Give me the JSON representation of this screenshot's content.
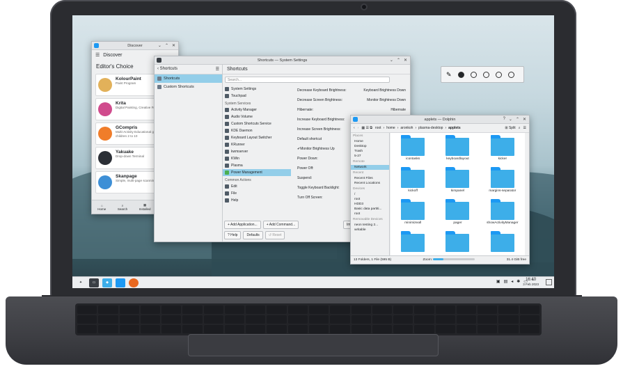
{
  "discover": {
    "title": "Discover",
    "header": "Discover",
    "editors_choice": "Editor's Choice",
    "apps": [
      {
        "name": "KolourPaint",
        "desc": "Paint Program",
        "color": "#e2b15a"
      },
      {
        "name": "Krita",
        "desc": "Digital Painting, Creative Freedom",
        "color": "#d04b8d"
      },
      {
        "name": "GCompris",
        "desc": "Multi-Activity Educational game for children 2 to 10",
        "color": "#f07d2a"
      },
      {
        "name": "Yakuake",
        "desc": "Drop-down Terminal",
        "color": "#2b2f36"
      },
      {
        "name": "Skanpage",
        "desc": "Simple, multi-page scanning application",
        "color": "#3d8fd6"
      }
    ],
    "nav": [
      "Home",
      "Search",
      "Installed",
      "Update"
    ]
  },
  "settings": {
    "title": "Shortcuts — System Settings",
    "sidebar_header": "Shortcuts",
    "sidebar_items": [
      "Shortcuts",
      "Custom Shortcuts"
    ],
    "page_title": "Shortcuts",
    "search_placeholder": "Search...",
    "list_top": [
      "System Settings",
      "Touchpad"
    ],
    "group_system": "System Services",
    "system_items": [
      "Activity Manager",
      "Audio Volume",
      "Custom Shortcuts Service",
      "KDE Daemon",
      "Keyboard Layout Switcher",
      "KRunner",
      "kwmserver",
      "KWin",
      "Plasma",
      "Power Management"
    ],
    "group_common": "Common Actions",
    "common_items": [
      "Edit",
      "File",
      "Help"
    ],
    "rows": [
      {
        "label": "Decrease Keyboard Brightness:",
        "value": "Keyboard Brightness Down"
      },
      {
        "label": "Decrease Screen Brightness:",
        "value": "Monitor Brightness Down"
      },
      {
        "label": "Hibernate:",
        "value": "Hibernate"
      },
      {
        "label": "Increase Keyboard Brightness:",
        "value": ""
      },
      {
        "label": "Increase Screen Brightness:",
        "value": ""
      }
    ],
    "default_shortcut": "Default shortcut",
    "default_value": "Monitor Brightness Up",
    "rows2": [
      "Power Down:",
      "Power Off:",
      "Suspend:",
      "Toggle Keyboard Backlight:",
      "Turn Off Screen:"
    ],
    "buttons": {
      "add_app": "Add Application...",
      "add_command": "Add Command...",
      "help": "Help",
      "defaults": "Defaults",
      "reset": "Reset",
      "import": "Import"
    }
  },
  "dolphin": {
    "title": "applets — Dolphin",
    "breadcrumb": [
      "root",
      "home",
      "aronkoh",
      "plasma-desktop",
      "applets"
    ],
    "split": "Split",
    "places_header": "Places",
    "places": [
      "Home",
      "Desktop",
      "Trash",
      "5-27"
    ],
    "remote_header": "Remote",
    "remote": [
      "Network"
    ],
    "recent_header": "Recent",
    "recent": [
      "Recent Files",
      "Recent Locations"
    ],
    "devices_header": "Devices",
    "devices": [
      "/",
      "root",
      "HDD3",
      "Basic data partiti...",
      "root"
    ],
    "removable_header": "Removable Devices",
    "removable": [
      "neon testing 2...",
      "writable"
    ],
    "folders": [
      "icontasks",
      "keyboardlayout",
      "kicker",
      "kickoff",
      "kimpanel",
      "margins-separator",
      "minimizeall",
      "pager",
      "showActivityManager",
      "",
      "",
      ""
    ],
    "status": "13 Folders, 1 File (595 B)",
    "zoom_label": "Zoom:",
    "zoom_level": 0.25,
    "free": "31.4 GiB free"
  },
  "clock": {
    "time": "16:40",
    "date": "3 Feb 2023"
  },
  "colors": {
    "accent": "#3daee9",
    "selection": "#93cee9"
  }
}
